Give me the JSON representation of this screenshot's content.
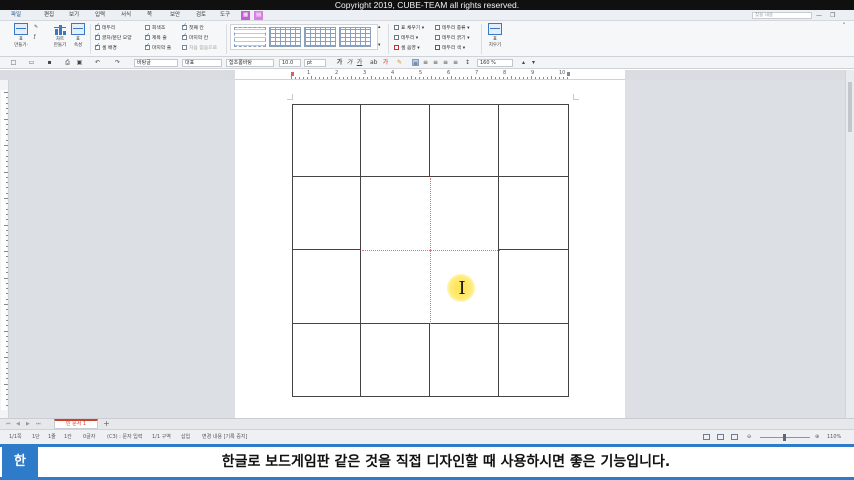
{
  "topbar": {
    "copyright": "Copyright 2019, CUBE-TEAM all rights reserved."
  },
  "menu": {
    "items": [
      "파일",
      "편집",
      "보기",
      "입력",
      "서식",
      "쪽",
      "보안",
      "검토",
      "도구"
    ],
    "search_placeholder": "찾을 내용"
  },
  "ribbon": {
    "table_btn": "표\n만들기",
    "chart_btn": "차트\n만들기",
    "props_btn": "표\n속성",
    "checks_col1": [
      {
        "label": "테두리",
        "checked": true
      },
      {
        "label": "글자/문단 모양",
        "checked": true
      },
      {
        "label": "셀 배경",
        "checked": true
      }
    ],
    "checks_col2": [
      {
        "label": "회색조",
        "checked": false
      },
      {
        "label": "제목 줄",
        "checked": true
      },
      {
        "label": "마지막 줄",
        "checked": true
      }
    ],
    "checks_col3": [
      {
        "label": "첫째 칸",
        "checked": true
      },
      {
        "label": "마지막 칸",
        "checked": true
      },
      {
        "label": "처음 없음으로",
        "checked": false
      }
    ],
    "fill_items": [
      "표 채우기",
      "테두리",
      "셀 음영"
    ],
    "border_items": [
      "테두리 종류",
      "테두리 굵기",
      "테두리 색"
    ],
    "delete_btn": "표\n지우기"
  },
  "format": {
    "style": "바탕글",
    "lang": "대표",
    "font": "함초롬바탕",
    "size": "10.0",
    "unit": "pt",
    "zoom": "160"
  },
  "ruler": {
    "numbers": [
      "1",
      "2",
      "3",
      "4",
      "5",
      "6",
      "7",
      "8",
      "9",
      "10"
    ]
  },
  "tabs": {
    "doc_tab": "빈 문서 1",
    "add": "+"
  },
  "status": {
    "page": "1/1쪽",
    "section": "1단",
    "line": "1줄",
    "column": "1칸",
    "chars": "0글자",
    "cell": "(C3) : 문자 입력",
    "area": "1/1 구역",
    "mode": "삽입",
    "track": "변경 내용 [기록 중지]",
    "zoom": "110%"
  },
  "caption": {
    "logo": "한",
    "text": "한글로 보드게임판 같은 것을 직접 디자인할 때 사용하시면 좋은 기능입니다."
  }
}
